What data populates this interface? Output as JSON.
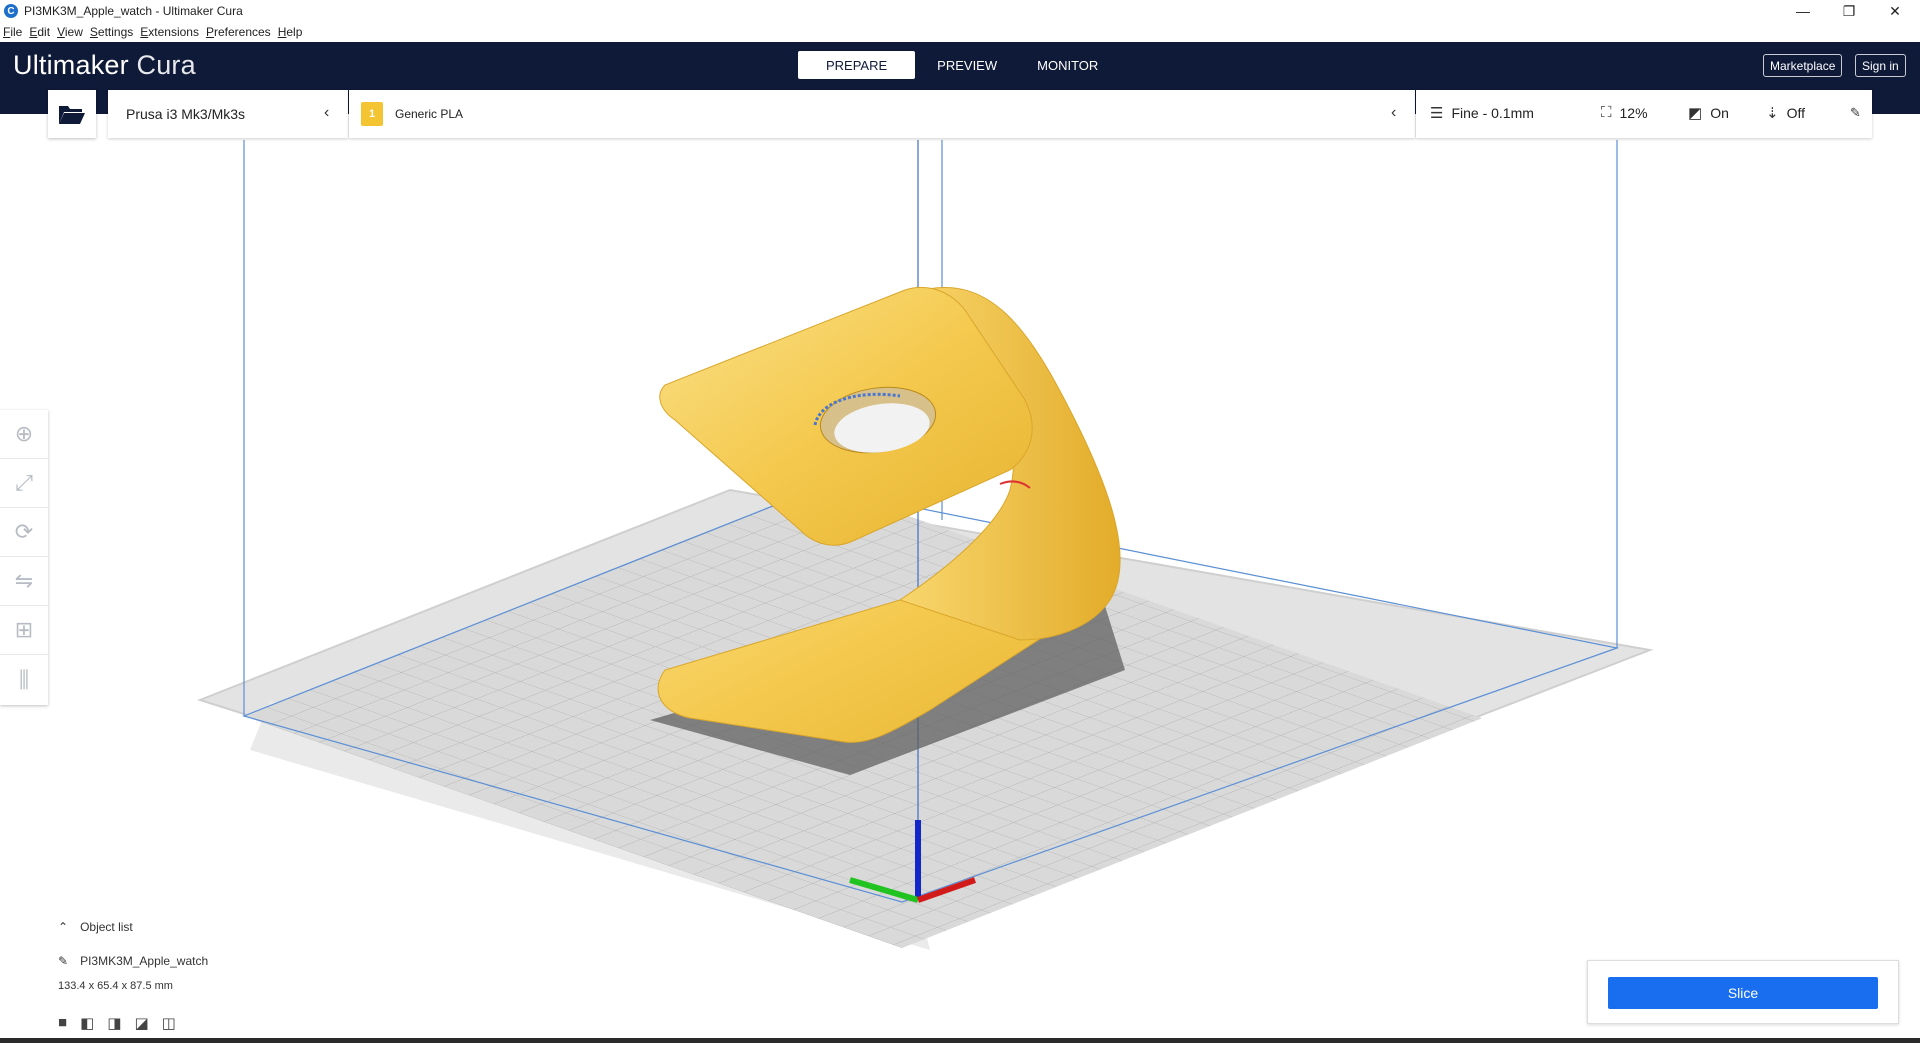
{
  "window": {
    "title": "PI3MK3M_Apple_watch - Ultimaker Cura",
    "minimize": "—",
    "restore": "❐",
    "close": "✕"
  },
  "menu": [
    "File",
    "Edit",
    "View",
    "Settings",
    "Extensions",
    "Preferences",
    "Help"
  ],
  "header": {
    "logo_bold": "Ultimaker",
    "logo_light": "Cura",
    "stages": [
      "PREPARE",
      "PREVIEW",
      "MONITOR"
    ],
    "active_stage": "PREPARE",
    "marketplace": "Marketplace",
    "signin": "Sign in"
  },
  "printer": {
    "name": "Prusa i3 Mk3/Mk3s"
  },
  "material": {
    "extruder": "1",
    "name": "Generic PLA"
  },
  "print_settings": {
    "profile": "Fine - 0.1mm",
    "infill": "12%",
    "support": "On",
    "adhesion": "Off"
  },
  "object_list": {
    "toggle_label": "Object list",
    "object_name": "PI3MK3M_Apple_watch",
    "dimensions": "133.4 x 65.4 x 87.5 mm"
  },
  "slice": {
    "label": "Slice"
  },
  "colors": {
    "header_bg": "#0f1938",
    "accent": "#196ef0",
    "model": "#f6d061",
    "extruder_badge": "#f4c432"
  }
}
